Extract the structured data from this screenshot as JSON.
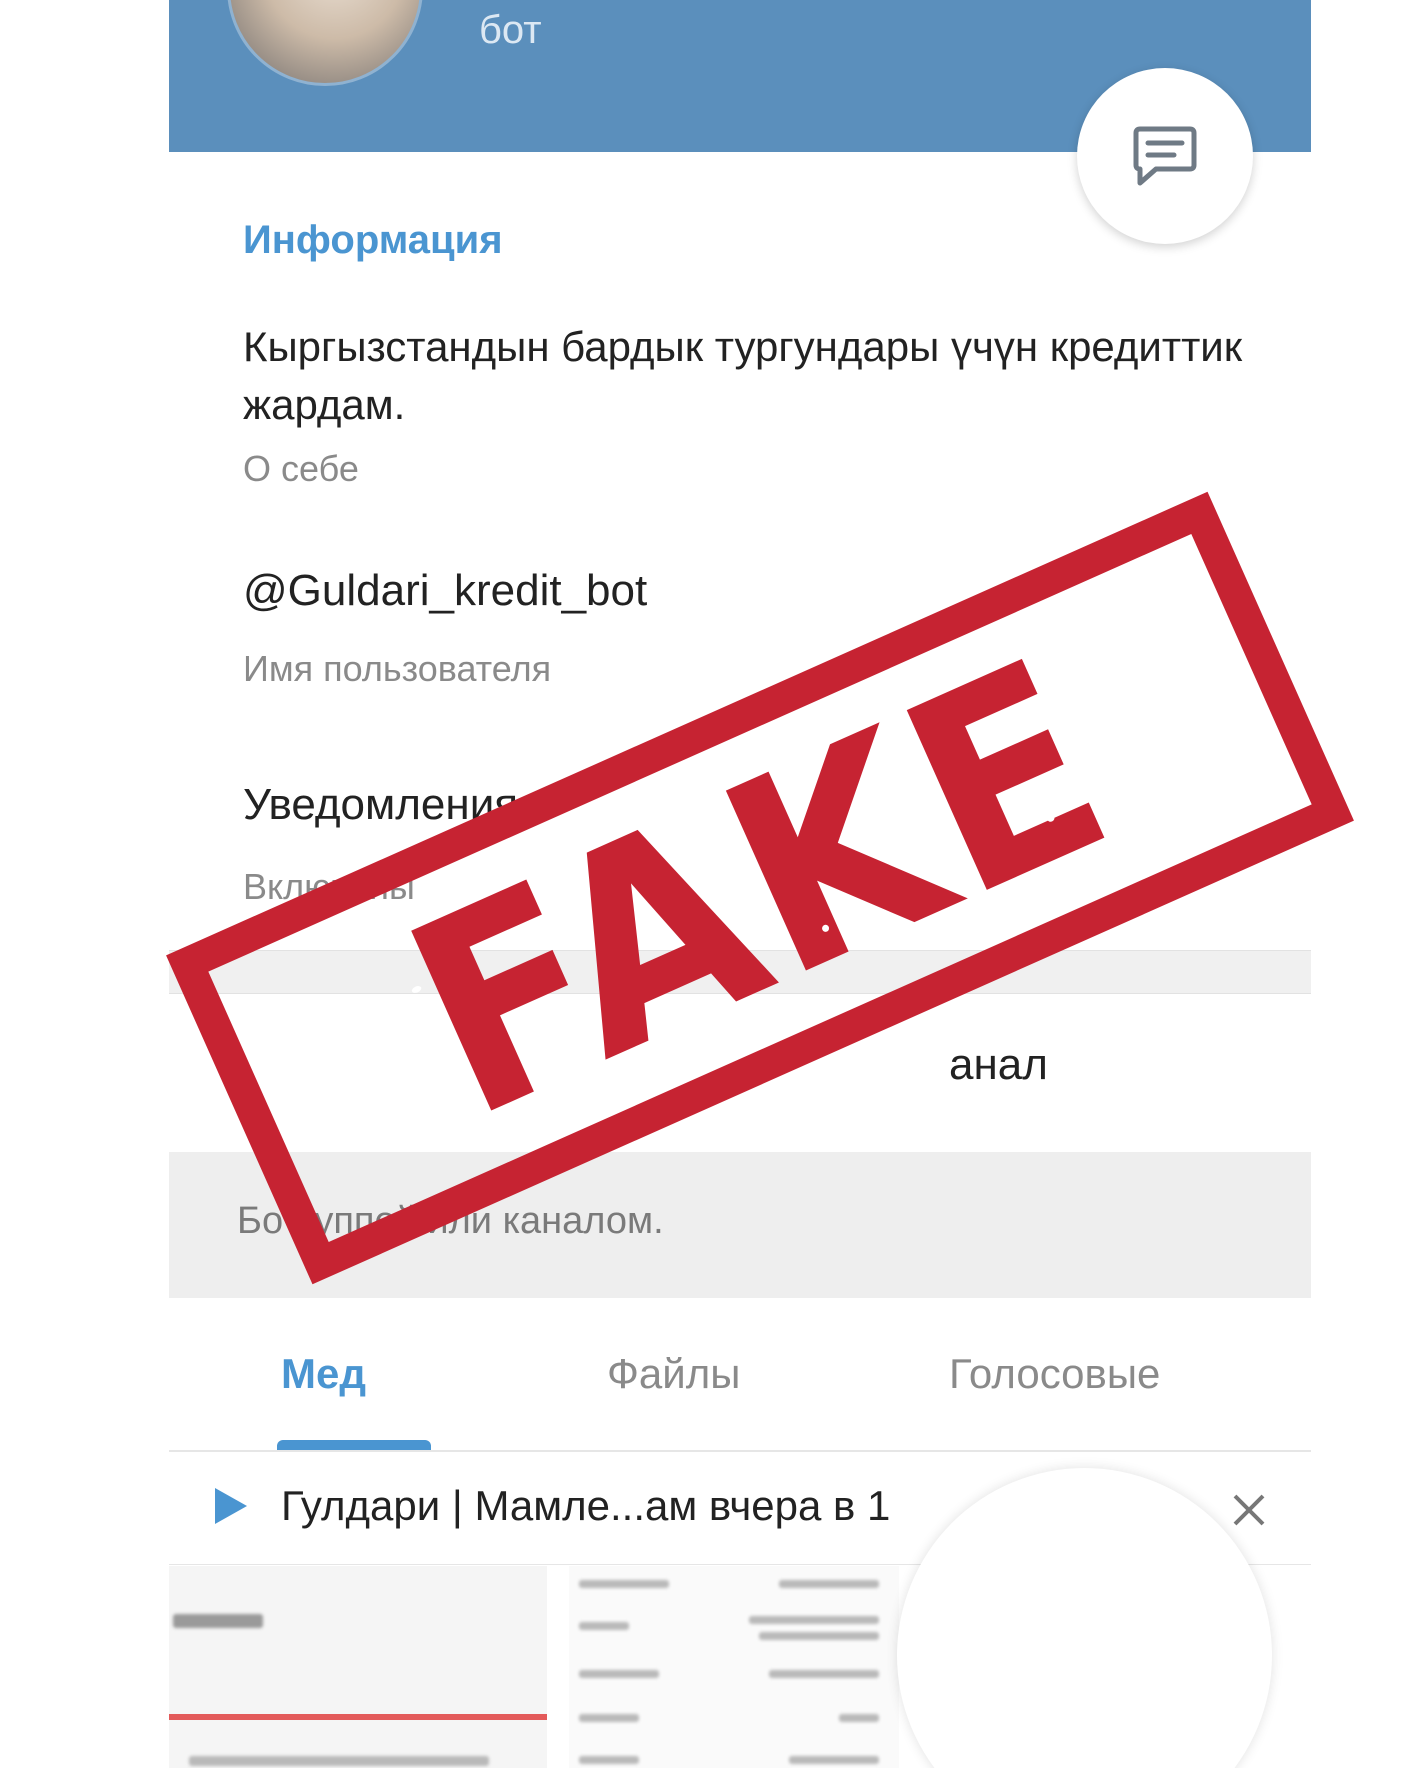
{
  "header": {
    "status": "бот"
  },
  "info": {
    "section_title": "Информация",
    "bio": "Кыргызстандын бардык тургундары үчүн кредиттик жардам.",
    "bio_caption": "О себе",
    "username": "@Guldari_kredit_bot",
    "username_caption": "Имя пользователя",
    "notifications": "Уведомления",
    "notifications_caption": "Включены"
  },
  "add_to": {
    "label": "анал"
  },
  "info_band": {
    "text": "Бо                    руппой или каналом."
  },
  "tabs": [
    {
      "label": "Мед",
      "active": true
    },
    {
      "label": "Файлы",
      "active": false
    },
    {
      "label": "Голосовые",
      "active": false
    }
  ],
  "player": {
    "title": "Гулдари | Мамле...ам вчера в 1"
  },
  "stamp": {
    "text": "FAKE",
    "color": "#c62332"
  },
  "colors": {
    "header": "#5b8fbc",
    "accent": "#4a95d1"
  },
  "icons": {
    "fab": "chat-icon",
    "play": "play-icon",
    "close": "close-icon"
  }
}
